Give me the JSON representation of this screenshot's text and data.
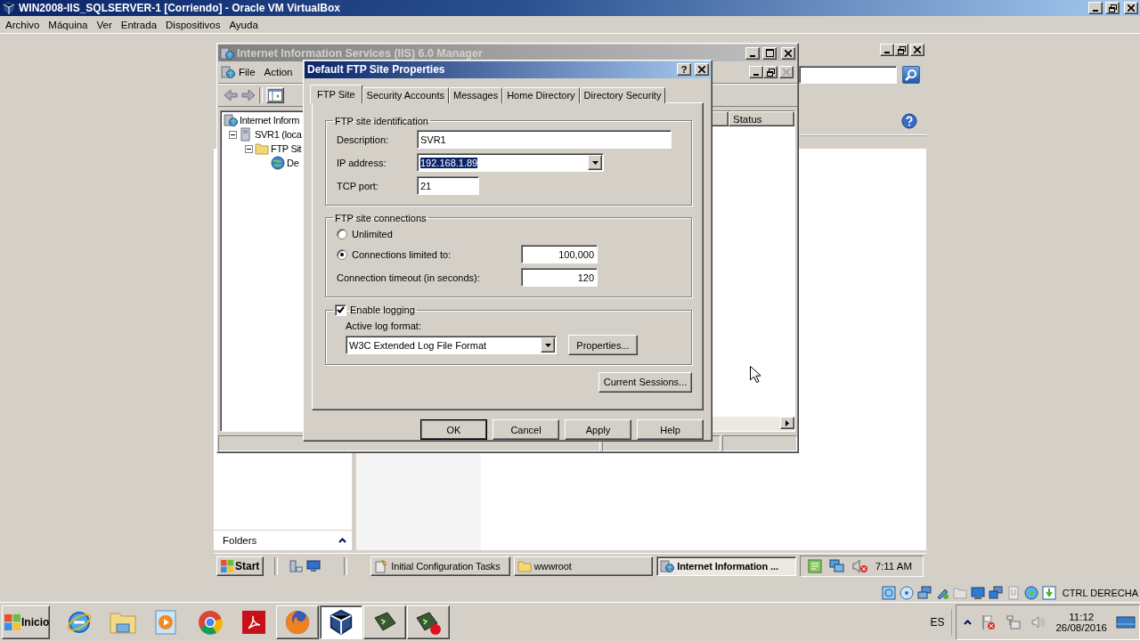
{
  "host_window": {
    "title": "WIN2008-IIS_SQLSERVER-1 [Corriendo] - Oracle VM VirtualBox"
  },
  "host_menu": [
    "Archivo",
    "Máquina",
    "Ver",
    "Entrada",
    "Dispositivos",
    "Ayuda"
  ],
  "iis_window": {
    "title": "Internet Information Services (IIS) 6.0 Manager",
    "menu": [
      "File",
      "Action"
    ],
    "tree": [
      {
        "label": "Internet Inform",
        "kind": "root",
        "children": [
          {
            "label": "SVR1 (loca",
            "kind": "server",
            "expanded": true,
            "children": [
              {
                "label": "FTP Sit",
                "kind": "folder",
                "expanded": true,
                "children": [
                  {
                    "label": "De",
                    "kind": "site"
                  }
                ]
              }
            ]
          }
        ]
      }
    ],
    "columns": [
      "Status"
    ]
  },
  "dialog": {
    "title": "Default FTP Site Properties",
    "help_button": "?",
    "tabs": [
      {
        "label": "FTP Site",
        "selected": true
      },
      {
        "label": "Security Accounts",
        "selected": false
      },
      {
        "label": "Messages",
        "selected": false
      },
      {
        "label": "Home Directory",
        "selected": false
      },
      {
        "label": "Directory Security",
        "selected": false
      }
    ],
    "identification": {
      "legend": "FTP site identification",
      "description": {
        "label": "Description:",
        "value": "SVR1"
      },
      "ip_address": {
        "label": "IP address:",
        "value": "192.168.1.89",
        "highlighted": true
      },
      "tcp_port": {
        "label": "TCP port:",
        "value": "21"
      }
    },
    "connections": {
      "legend": "FTP site connections",
      "options": [
        {
          "label": "Unlimited",
          "selected": false
        },
        {
          "label": "Connections limited to:",
          "selected": true
        }
      ],
      "limit": "100,000",
      "timeout": {
        "label": "Connection timeout (in seconds):",
        "value": "120"
      }
    },
    "logging": {
      "label": "Enable logging",
      "checked": true,
      "format_label": "Active log format:",
      "format": "W3C Extended Log File Format",
      "properties_button": "Properties..."
    },
    "sessions_button": "Current Sessions...",
    "buttons": [
      {
        "label": "OK",
        "default": true
      },
      {
        "label": "Cancel",
        "default": false
      },
      {
        "label": "Apply",
        "default": false
      },
      {
        "label": "Help",
        "default": false
      }
    ]
  },
  "folders_pane": {
    "label": "Folders"
  },
  "guest_taskbar": {
    "start": "Start",
    "tasks": [
      {
        "label": "Initial Configuration Tasks",
        "kind": "tasks",
        "selected": false
      },
      {
        "label": "wwwroot",
        "kind": "folder",
        "selected": false
      },
      {
        "label": "Internet Information ...",
        "kind": "iis",
        "selected": true
      }
    ],
    "clock": "7:11 AM"
  },
  "host_status": {
    "hotkey": "CTRL DERECHA"
  },
  "host_taskbar": {
    "start": "Inicio",
    "apps": [
      {
        "kind": "ie",
        "open": false,
        "selected": false
      },
      {
        "kind": "explorer",
        "open": false,
        "selected": false
      },
      {
        "kind": "media",
        "open": false,
        "selected": false
      },
      {
        "kind": "chrome",
        "open": false,
        "selected": false
      },
      {
        "kind": "pdf",
        "open": false,
        "selected": false
      },
      {
        "kind": "firefox",
        "open": true,
        "selected": false
      },
      {
        "kind": "virtualbox",
        "open": true,
        "selected": true
      },
      {
        "kind": "console",
        "open": true,
        "selected": false
      },
      {
        "kind": "console-rec",
        "open": true,
        "selected": false
      }
    ],
    "language": "ES",
    "time": "11:12",
    "date": "26/08/2016"
  }
}
